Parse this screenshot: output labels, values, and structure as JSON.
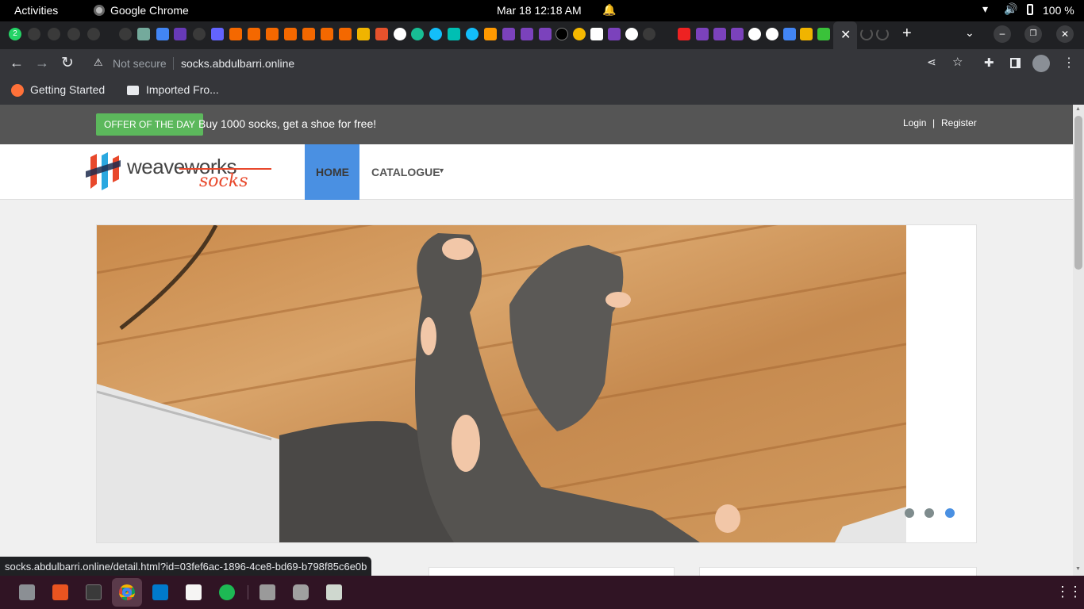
{
  "system": {
    "activities": "Activities",
    "app_name": "Google Chrome",
    "datetime": "Mar 18  12:18 AM",
    "battery": "100 %"
  },
  "tabs": {
    "badge_count": "2"
  },
  "address": {
    "security_label": "Not secure",
    "url": "socks.abdulbarri.online"
  },
  "bookmarks": [
    {
      "label": "Getting Started"
    },
    {
      "label": "Imported Fro..."
    }
  ],
  "site": {
    "offer_badge": "OFFER OF THE DAY",
    "offer_text": "Buy 1000 socks, get a shoe for free!",
    "login": "Login",
    "separator": "|",
    "register": "Register",
    "logo_main": "weaveworks",
    "logo_sub": "socks",
    "nav": [
      {
        "label": "HOME",
        "active": true
      },
      {
        "label": "CATALOGUE",
        "active": false
      }
    ],
    "carousel": {
      "dots": 3,
      "active_dot": 3
    }
  },
  "statusbar": {
    "link": "socks.abdulbarri.online/detail.html?id=03fef6ac-1896-4ce8-bd69-b798f85c6e0b"
  },
  "colors": {
    "offer_green": "#5cb85c",
    "nav_active": "#4a90e2",
    "taskbar": "#301424"
  }
}
